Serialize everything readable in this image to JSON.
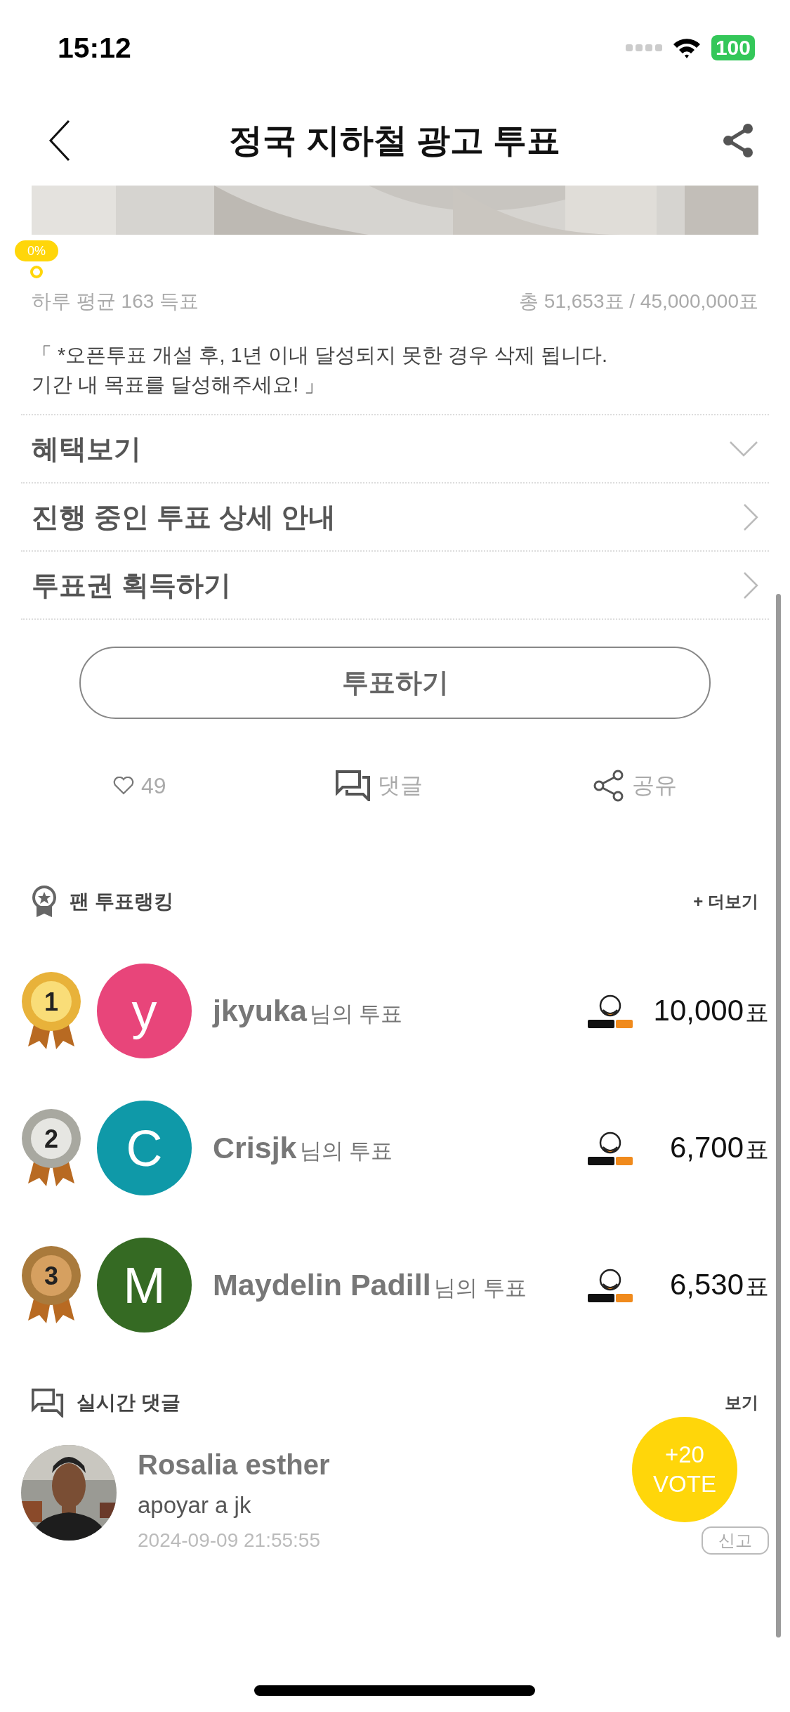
{
  "status_bar": {
    "time": "15:12",
    "battery": "100"
  },
  "nav": {
    "title": "정국 지하철 광고 투표"
  },
  "progress": {
    "label": "0%"
  },
  "stats": {
    "daily": "하루 평균 163 득표",
    "total": "총 51,653표 / 45,000,000표"
  },
  "notice": [
    "「 *오픈투표 개설 후, 1년 이내 달성되지 못한 경우 삭제 됩니다.",
    "기간 내 목표를 달성해주세요! 」"
  ],
  "menu": [
    {
      "label": "혜택보기",
      "kind": "expand"
    },
    {
      "label": "진행 중인 투표 상세 안내",
      "kind": "link"
    },
    {
      "label": "투표권 획득하기",
      "kind": "link"
    }
  ],
  "vote_button": "투표하기",
  "actions": {
    "likes": "49",
    "comment": "댓글",
    "share": "공유"
  },
  "ranking": {
    "title": "팬 투표랭킹",
    "more": "+ 더보기",
    "rows": [
      {
        "rank": "1",
        "initial": "y",
        "color": "#e8457a",
        "name": "jkyuka",
        "suffix": "님의 투표",
        "votes": "10,000",
        "unit": "표"
      },
      {
        "rank": "2",
        "initial": "C",
        "color": "#0f99a8",
        "name": "Crisjk",
        "suffix": "님의 투표",
        "votes": "6,700",
        "unit": "표"
      },
      {
        "rank": "3",
        "initial": "M",
        "color": "#356a23",
        "name": "Maydelin Padill",
        "suffix": "님의 투표",
        "votes": "6,530",
        "unit": "표"
      }
    ]
  },
  "comments": {
    "title": "실시간 댓글",
    "more": "보기",
    "items": [
      {
        "name": "Rosalia esther",
        "text": "apoyar a jk",
        "date": "2024-09-09 21:55:55",
        "report": "신고"
      }
    ]
  },
  "fab": [
    "+20",
    "VOTE"
  ]
}
